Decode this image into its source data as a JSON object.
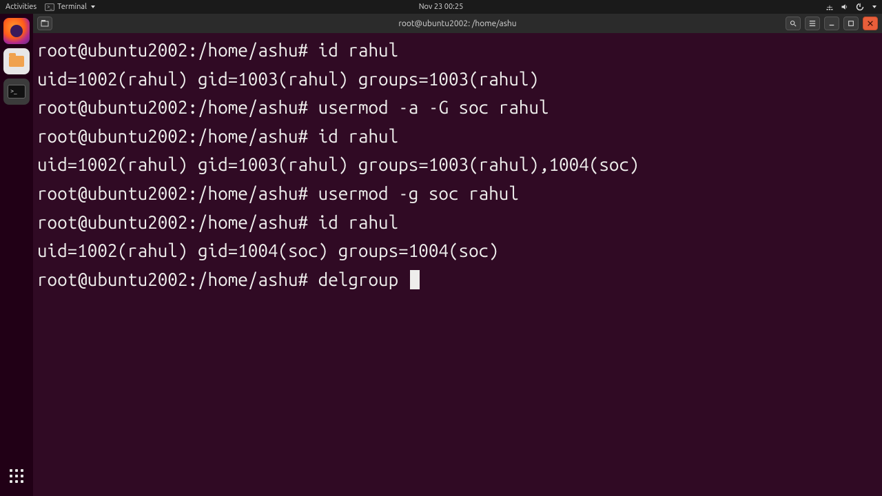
{
  "panel": {
    "activities": "Activities",
    "app_menu": "Terminal",
    "clock": "Nov 23  00:25"
  },
  "titlebar": {
    "title": "root@ubuntu2002: /home/ashu"
  },
  "terminal": {
    "prompt": "root@ubuntu2002:/home/ashu#",
    "lines": [
      {
        "prompt": true,
        "cmd": "id rahul"
      },
      {
        "out": "uid=1002(rahul) gid=1003(rahul) groups=1003(rahul)"
      },
      {
        "prompt": true,
        "cmd": "usermod -a -G soc rahul"
      },
      {
        "prompt": true,
        "cmd": "id rahul"
      },
      {
        "out": "uid=1002(rahul) gid=1003(rahul) groups=1003(rahul),1004(soc)"
      },
      {
        "prompt": true,
        "cmd": "usermod -g soc rahul"
      },
      {
        "prompt": true,
        "cmd": "id rahul"
      },
      {
        "out": "uid=1002(rahul) gid=1004(soc) groups=1004(soc)"
      },
      {
        "prompt": true,
        "cmd": "delgroup ",
        "cursor": true
      }
    ]
  }
}
